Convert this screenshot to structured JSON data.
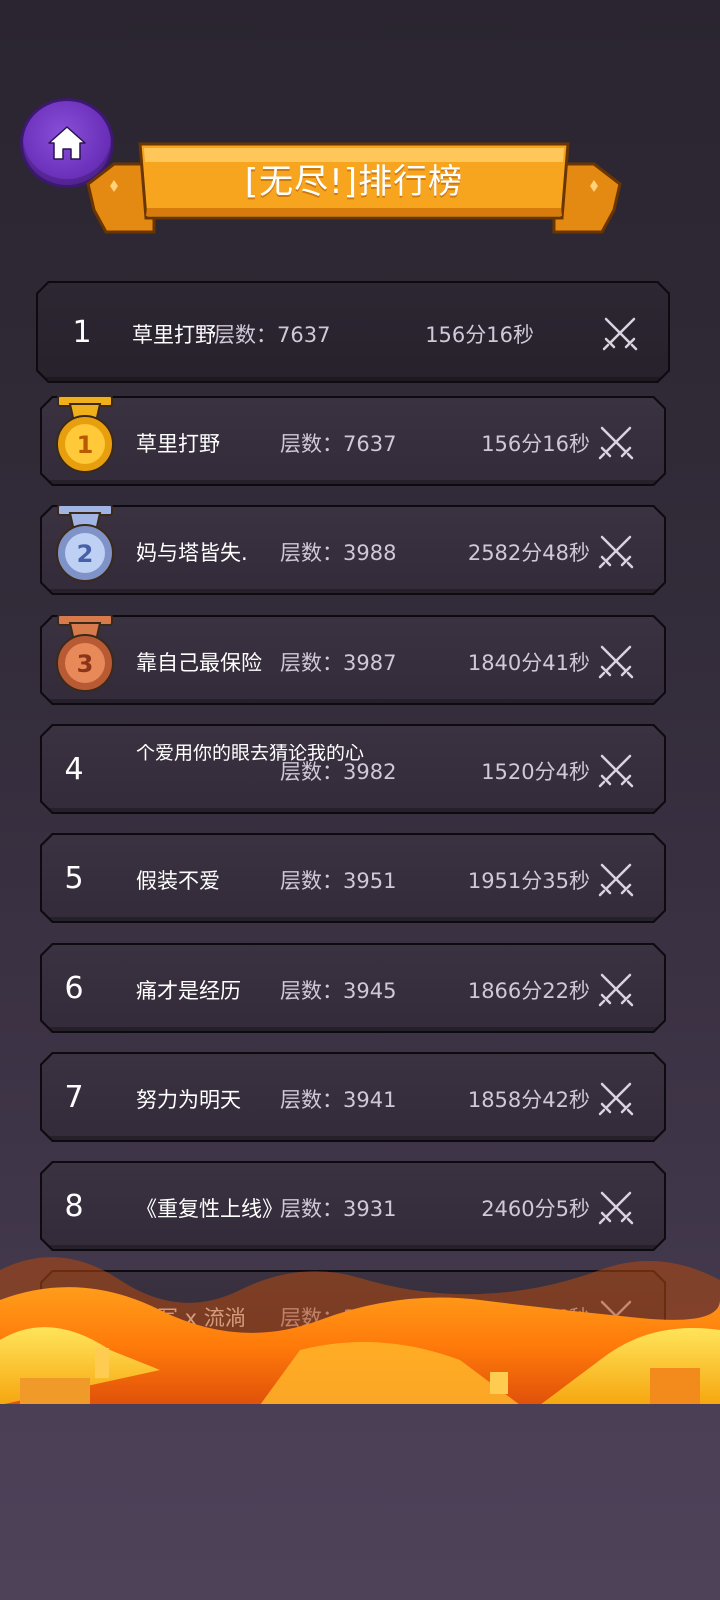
{
  "header": {
    "title": "[无尽!]排行榜",
    "home_icon": "home-icon"
  },
  "my_rank": {
    "rank": "1",
    "name": "草里打野",
    "floors": "层数：7637",
    "time": "156分16秒",
    "icon": "crossed-swords-icon"
  },
  "leaderboard": [
    {
      "rank": "1",
      "medal": "gold",
      "name": "草里打野",
      "floors": "层数：7637",
      "time": "156分16秒"
    },
    {
      "rank": "2",
      "medal": "silver",
      "name": "妈与塔皆失.",
      "floors": "层数：3988",
      "time": "2582分48秒"
    },
    {
      "rank": "3",
      "medal": "bronze",
      "name": "靠自己最保险",
      "floors": "层数：3987",
      "time": "1840分41秒"
    },
    {
      "rank": "4",
      "name": "个爱用你的眼去猜论我的心",
      "floors": "层数：3982",
      "time": "1520分4秒"
    },
    {
      "rank": "5",
      "name": "假装不爱",
      "floors": "层数：3951",
      "time": "1951分35秒"
    },
    {
      "rank": "6",
      "name": "痛才是经历",
      "floors": "层数：3945",
      "time": "1866分22秒"
    },
    {
      "rank": "7",
      "name": "努力为明天",
      "floors": "层数：3941",
      "time": "1858分42秒"
    },
    {
      "rank": "8",
      "name": "《重复性上线》",
      "floors": "层数：3931",
      "time": "2460分5秒"
    },
    {
      "rank": "9",
      "name": "淡写 x 流淌",
      "floors": "层数：3923",
      "time": "1573分16秒"
    }
  ],
  "colors": {
    "ribbon": "#f5a623",
    "home_button": "#7a3fd0",
    "gold_medal": "#f2b01e",
    "silver_medal": "#9fb3e6",
    "bronze_medal": "#d97a4f",
    "row_bg": "#352d3b"
  }
}
